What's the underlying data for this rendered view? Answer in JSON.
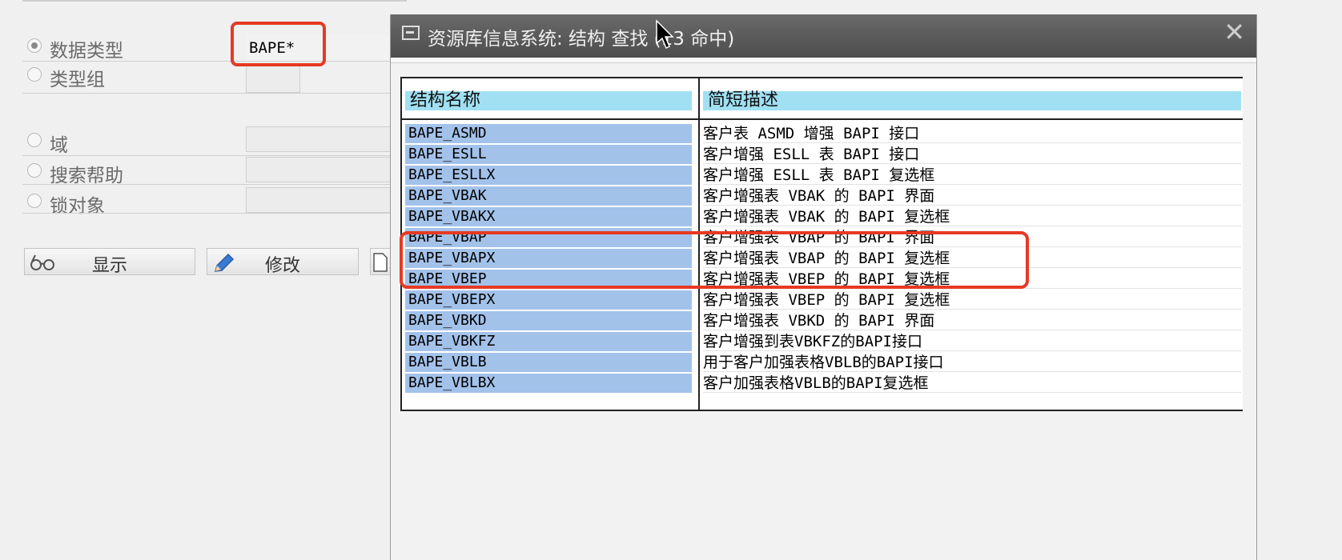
{
  "left_panel": {
    "options": [
      {
        "label": "数据类型",
        "checked": true
      },
      {
        "label": "类型组",
        "checked": false
      },
      {
        "label": "域",
        "checked": false
      },
      {
        "label": "搜索帮助",
        "checked": false
      },
      {
        "label": "锁对象",
        "checked": false
      }
    ],
    "data_type_value": "BAPE*",
    "buttons": {
      "display_label": "显示",
      "display_icon": "glasses-icon",
      "change_label": "修改",
      "change_icon": "pencil-icon"
    }
  },
  "dialog": {
    "title": "资源库信息系统: 结构 查找 (13 命中)",
    "close_glyph": "✕",
    "columns": [
      "结构名称",
      "简短描述"
    ],
    "rows": [
      {
        "name": "BAPE_ASMD",
        "desc": "客户表 ASMD 增强 BAPI 接口"
      },
      {
        "name": "BAPE_ESLL",
        "desc": "客户增强 ESLL 表 BAPI 接口"
      },
      {
        "name": "BAPE_ESLLX",
        "desc": "客户增强 ESLL 表 BAPI 复选框"
      },
      {
        "name": "BAPE_VBAK",
        "desc": "客户增强表 VBAK 的 BAPI 界面"
      },
      {
        "name": "BAPE_VBAKX",
        "desc": "客户增强表 VBAK 的 BAPI 复选框"
      },
      {
        "name": "BAPE_VBAP",
        "desc": "客户增强表 VBAP 的 BAPI 界面"
      },
      {
        "name": "BAPE_VBAPX",
        "desc": "客户增强表 VBAP 的 BAPI 复选框"
      },
      {
        "name": "BAPE_VBEP",
        "desc": "客户增强表 VBEP 的 BAPI 复选框"
      },
      {
        "name": "BAPE_VBEPX",
        "desc": "客户增强表 VBEP 的 BAPI 复选框"
      },
      {
        "name": "BAPE_VBKD",
        "desc": "客户增强表 VBKD 的 BAPI 界面"
      },
      {
        "name": "BAPE_VBKFZ",
        "desc": "客户增强到表VBKFZ的BAPI接口"
      },
      {
        "name": "BAPE_VBLB",
        "desc": "用于客户加强表格VBLB的BAPI接口"
      },
      {
        "name": "BAPE_VBLBX",
        "desc": "客户加强表格VBLB的BAPI复选框"
      }
    ]
  },
  "colors": {
    "highlight": "#e53a24",
    "name_cell": "#a3c2ea",
    "header_cell": "#a0e0f2"
  }
}
